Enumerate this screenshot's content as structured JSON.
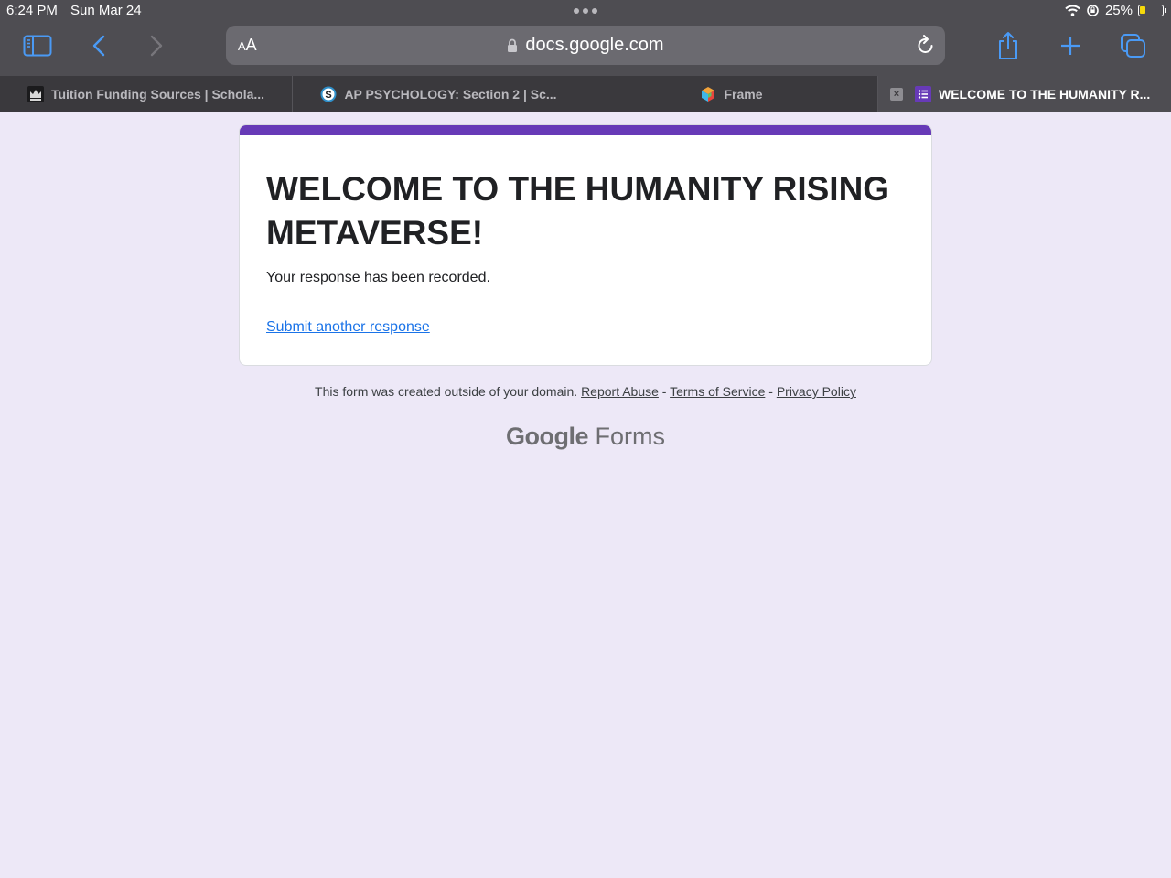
{
  "status": {
    "time": "6:24 PM",
    "date": "Sun Mar 24",
    "battery": "25%",
    "battery_level": 0.25
  },
  "toolbar": {
    "text_size_label_small": "A",
    "text_size_label_large": "A",
    "url": "docs.google.com"
  },
  "tabs": [
    {
      "title": "Tuition Funding Sources | Schola...",
      "icon": "crown-icon"
    },
    {
      "title": "AP PSYCHOLOGY: Section 2 | Sc...",
      "icon": "schoology-icon"
    },
    {
      "title": "Frame",
      "icon": "cube-icon"
    },
    {
      "title": "WELCOME TO THE HUMANITY R...",
      "icon": "forms-icon",
      "active": true
    }
  ],
  "form": {
    "title": "WELCOME TO THE HUMANITY RISING METAVERSE!",
    "message": "Your response has been recorded.",
    "link": "Submit another response"
  },
  "footer": {
    "text": "This form was created outside of your domain.",
    "report_abuse": "Report Abuse",
    "sep1": " - ",
    "terms": "Terms of Service",
    "sep2": " - ",
    "privacy": "Privacy Policy"
  },
  "brand": {
    "google": "Google",
    "forms": "Forms"
  },
  "colors": {
    "accent": "#673ab7",
    "link": "#1a73e8",
    "page_bg": "#ede8f7",
    "safari_blue": "#4a9af5"
  }
}
